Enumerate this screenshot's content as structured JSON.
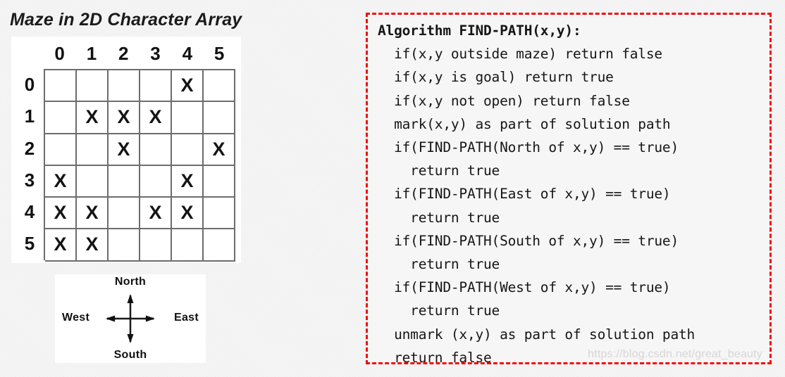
{
  "maze": {
    "title": "Maze in 2D Character Array",
    "column_headers": [
      "0",
      "1",
      "2",
      "3",
      "4",
      "5"
    ],
    "row_headers": [
      "0",
      "1",
      "2",
      "3",
      "4",
      "5"
    ],
    "wall_char": "X",
    "grid": [
      [
        "",
        "",
        "",
        "",
        "X",
        ""
      ],
      [
        "",
        "X",
        "X",
        "X",
        "",
        ""
      ],
      [
        "",
        "",
        "X",
        "",
        "",
        "X"
      ],
      [
        "X",
        "",
        "",
        "",
        "X",
        ""
      ],
      [
        "X",
        "X",
        "",
        "X",
        "X",
        ""
      ],
      [
        "X",
        "X",
        "",
        "",
        "",
        ""
      ]
    ]
  },
  "compass": {
    "north": "North",
    "south": "South",
    "west": "West",
    "east": "East"
  },
  "code": {
    "border_color": "#f50b0b",
    "lines": [
      {
        "text": "Algorithm FIND-PATH(x,y):",
        "bold": true
      },
      {
        "text": "  if(x,y outside maze) return false",
        "bold": false
      },
      {
        "text": "  if(x,y is goal) return true",
        "bold": false
      },
      {
        "text": "  if(x,y not open) return false",
        "bold": false
      },
      {
        "text": "  mark(x,y) as part of solution path",
        "bold": false
      },
      {
        "text": "  if(FIND-PATH(North of x,y) == true)",
        "bold": false
      },
      {
        "text": "    return true",
        "bold": false
      },
      {
        "text": "  if(FIND-PATH(East of x,y) == true)",
        "bold": false
      },
      {
        "text": "    return true",
        "bold": false
      },
      {
        "text": "  if(FIND-PATH(South of x,y) == true)",
        "bold": false
      },
      {
        "text": "    return true",
        "bold": false
      },
      {
        "text": "  if(FIND-PATH(West of x,y) == true)",
        "bold": false
      },
      {
        "text": "    return true",
        "bold": false
      },
      {
        "text": "  unmark (x,y) as part of solution path",
        "bold": false
      },
      {
        "text": "  return false",
        "bold": false
      }
    ]
  },
  "watermark": {
    "text": "https://blog.csdn.net/great_beauty"
  }
}
